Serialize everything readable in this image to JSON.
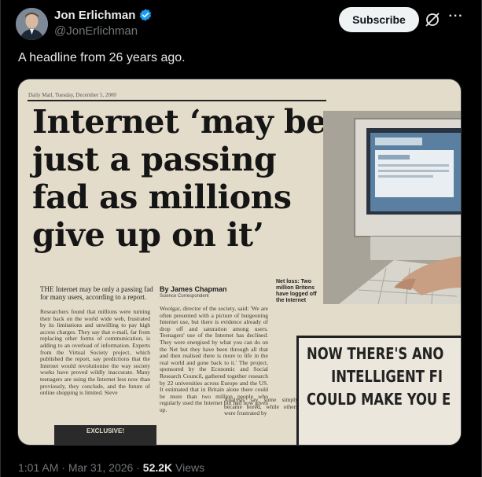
{
  "author": {
    "display_name": "Jon Erlichman",
    "handle": "@JonErlichman",
    "verified": true,
    "verified_color": "#1d9bf0"
  },
  "actions": {
    "subscribe_label": "Subscribe",
    "grok_icon": "grok-icon",
    "more_icon": "more-icon"
  },
  "tweet": {
    "text": "A headline from 26 years ago."
  },
  "newspaper": {
    "masthead": "Daily Mail, Tuesday, December 5, 2000",
    "headline_lines": [
      "Internet ‘may be",
      "just a passing",
      "fad as millions",
      "give up on it’"
    ],
    "lede": "THE Internet may be only a passing fad for many users, according to a report.",
    "byline_author": "By James Chapman",
    "byline_role": "Science Correspondent",
    "photo_caption": "Net loss: Two million Britons have logged off the Internet",
    "column1": "Researchers found that millions were turning their back on the world wide web, frustrated by its limitations and unwilling to pay high access charges. They say that e-mail, far from replacing other forms of communication, is adding to an overload of information. Experts from the Virtual Society project, which published the report, say predictions that the Internet would revolutionise the way society works have proved wildly inaccurate. Many teenagers are using the Internet less now than previously, they conclude, and the future of online shopping is limited. Steve",
    "column2": "Woolgar, director of the society, said: 'We are often presented with a picture of burgeoning Internet use, but there is evidence already of drop off and saturation among users. Teenagers' use of the Internet has declined. They were energised by what you can do on the Net but they have been through all that and then realised there is more to life in the real world and gone back to it.' The project, sponsored by the Economic and Social Research Council, gathered together research by 22 universities across Europe and the US. It estimated that in Britain alone there could be more than two million people who regularly used the Internet but had now given up.",
    "column3": "Analysts say some simply became bored, while others were frustrated by",
    "exclusive_label": "EXCLUSIVE!",
    "ad_lines": [
      "NOW THERE'S ANO",
      "INTELLIGENT FI",
      "COULD MAKE YOU E"
    ]
  },
  "meta": {
    "time": "1:01 AM",
    "separator": "·",
    "date": "Mar 31, 2026",
    "views_count": "52.2K",
    "views_label": "Views"
  }
}
